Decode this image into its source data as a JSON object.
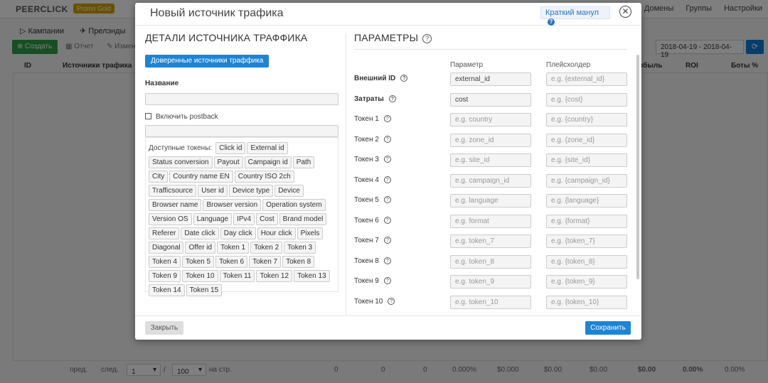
{
  "app": {
    "logo": "PEERCLICK",
    "promo_badge": "Promo Gold",
    "top_nav": [
      "Домены",
      "Группы",
      "Настройки"
    ]
  },
  "subnav": {
    "campaigns": "Кампании",
    "landers": "Прелэнды"
  },
  "toolbar": {
    "create": "Создать",
    "report": "Отчет",
    "edit": "Измен",
    "date_range": "2018-04-19 - 2018-04-19"
  },
  "table": {
    "col_id": "ID",
    "col_sources": "Источники трафика",
    "col_profit": "ибыль",
    "col_roi": "ROI",
    "col_bots": "Боты %"
  },
  "footer": {
    "prev": "пред.",
    "next": "след.",
    "page": "1",
    "sep": "/",
    "per_page": "100",
    "per_page_suffix": "на стр.",
    "totals": [
      "0",
      "0",
      "0",
      "0.000%",
      "$0.000",
      "$0.00",
      "$0.00",
      "$0.00",
      "0.00%",
      "0.00%"
    ]
  },
  "modal": {
    "title": "Новый источник трафика",
    "manual_link": "Краткий манул",
    "left": {
      "section_title": "ДЕТАЛИ ИСТОЧНИКА ТРАФФИКА",
      "trusted_button": "Доверенные источники траффика",
      "name_label": "Название",
      "name_value": "",
      "postback_label": "Включить postback",
      "postback_value": "",
      "tokens_label": "Доступные токены:",
      "tokens": [
        "Click id",
        "External id",
        "Status conversion",
        "Payout",
        "Campaign id",
        "Path",
        "City",
        "Country name EN",
        "Country ISO 2ch",
        "Trafficsource",
        "User id",
        "Device type",
        "Device",
        "Browser name",
        "Browser version",
        "Operation system",
        "Version OS",
        "Language",
        "IPv4",
        "Cost",
        "Brand model",
        "Referer",
        "Date click",
        "Day click",
        "Hour click",
        "Pixels",
        "Diagonal",
        "Offer id",
        "Token 1",
        "Token 2",
        "Token 3",
        "Token 4",
        "Token 5",
        "Token 6",
        "Token 7",
        "Token 8",
        "Token 9",
        "Token 10",
        "Token 11",
        "Token 12",
        "Token 13",
        "Token 14",
        "Token 15"
      ]
    },
    "right": {
      "section_title": "ПАРАМЕТРЫ",
      "col_param": "Параметр",
      "col_placeholder": "Плейсхолдер",
      "rows": [
        {
          "label": "Внешний ID",
          "bold": true,
          "param": "external_id",
          "param_is_value": true,
          "placeholder": "e.g. {external_id}"
        },
        {
          "label": "Затраты",
          "bold": true,
          "param": "cost",
          "param_is_value": true,
          "placeholder": "e.g. {cost}"
        },
        {
          "label": "Токен 1",
          "bold": false,
          "param": "e.g. country",
          "param_is_value": false,
          "placeholder": "e.g. {country}"
        },
        {
          "label": "Токен 2",
          "bold": false,
          "param": "e.g. zone_id",
          "param_is_value": false,
          "placeholder": "e.g. {zone_id}"
        },
        {
          "label": "Токен 3",
          "bold": false,
          "param": "e.g. site_id",
          "param_is_value": false,
          "placeholder": "e.g. {site_id}"
        },
        {
          "label": "Токен 4",
          "bold": false,
          "param": "e.g. campaign_id",
          "param_is_value": false,
          "placeholder": "e.g. {campaign_id}"
        },
        {
          "label": "Токен 5",
          "bold": false,
          "param": "e.g. language",
          "param_is_value": false,
          "placeholder": "e.g. {language}"
        },
        {
          "label": "Токен 6",
          "bold": false,
          "param": "e.g. format",
          "param_is_value": false,
          "placeholder": "e.g. {format}"
        },
        {
          "label": "Токен 7",
          "bold": false,
          "param": "e.g. token_7",
          "param_is_value": false,
          "placeholder": "e.g. {token_7}"
        },
        {
          "label": "Токен 8",
          "bold": false,
          "param": "e.g. token_8",
          "param_is_value": false,
          "placeholder": "e.g. {token_8}"
        },
        {
          "label": "Токен 9",
          "bold": false,
          "param": "e.g. token_9",
          "param_is_value": false,
          "placeholder": "e.g. {token_9}"
        },
        {
          "label": "Токен 10",
          "bold": false,
          "param": "e.g. token_10",
          "param_is_value": false,
          "placeholder": "e.g. {token_10}"
        }
      ]
    },
    "close_button": "Закрыть",
    "save_button": "Сохранить"
  }
}
